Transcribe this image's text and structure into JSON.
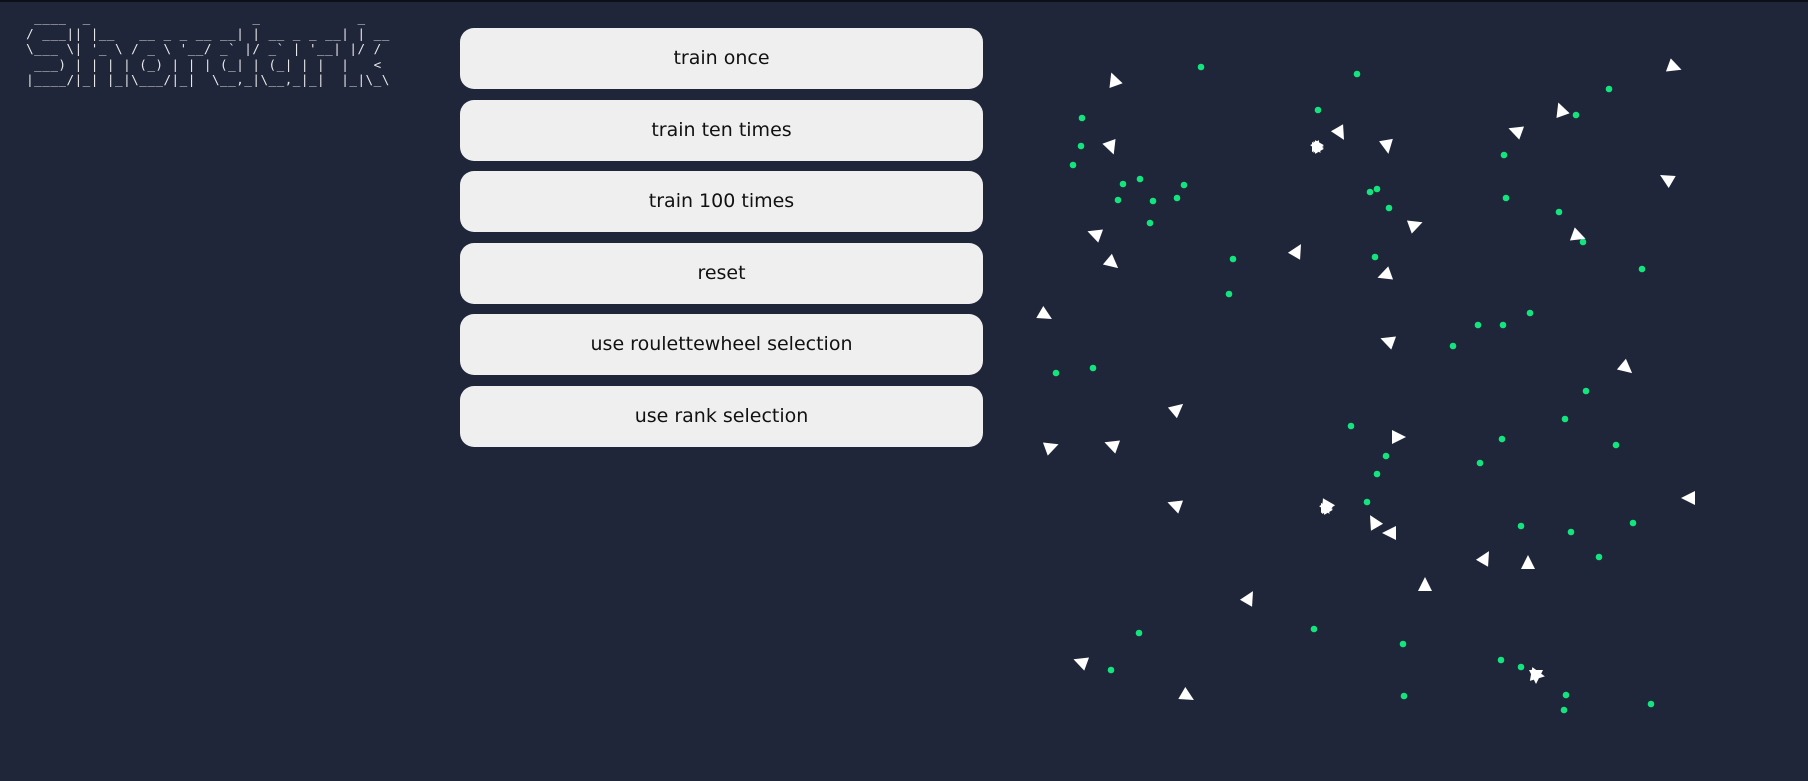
{
  "logo": {
    "text": "  ____  _                    _            _    \n / ___|| |__   __ _ _ __ __| | __ _ _ __| | __\n \\___ \\| '_ \\ / _ \\ '__/ _` |/ _` | '__| |/ /\n  ___) | | | | (_) | | | (_| | (_| | |  |   < \n |____/|_| |_|\\___/|_|  \\__,_|\\__,_|_|  |_|\\_\\"
  },
  "controls": {
    "buttons": [
      {
        "label": "train once"
      },
      {
        "label": "train ten times"
      },
      {
        "label": "train 100 times"
      },
      {
        "label": "reset"
      },
      {
        "label": "use roulettewheel selection"
      },
      {
        "label": "use rank selection"
      }
    ]
  },
  "simulation": {
    "colors": {
      "background": "#20263a",
      "food": "#13e47d",
      "agent": "#ffffff"
    }
  }
}
